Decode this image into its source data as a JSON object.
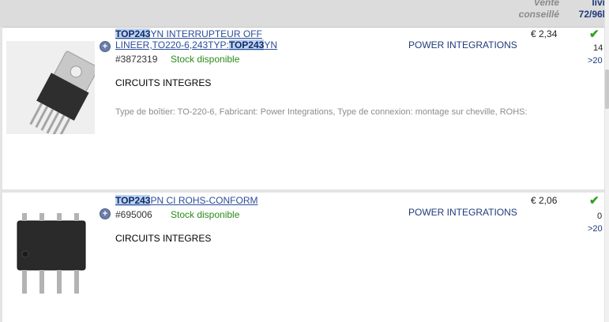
{
  "header": {
    "vente_line1": "Vente",
    "vente_line2": "conseillé",
    "livraison_line1": "livr.",
    "livraison_line2": "72/96h"
  },
  "products": [
    {
      "title_highlight_1": "TOP243",
      "title_rest_1": "YN INTERRUPTEUR OFF",
      "title_line2_a": "LINEER,TO220-6,243TYP:",
      "title_highlight_2": "TOP243",
      "title_line2_b": "YN",
      "ref": "#3872319",
      "stock": "Stock disponible",
      "category": "CIRCUITS INTEGRES",
      "description": "Type de boîtier: TO-220-6, Fabricant: Power Integrations, Type de connexion: montage sur cheville, ROHS:",
      "manufacturer": "POWER INTEGRATIONS",
      "price": "€ 2,34",
      "qty": "14",
      "delay": ">20"
    },
    {
      "title_highlight_1": "TOP243",
      "title_rest_1": "PN CI ROHS-CONFORM",
      "ref": "#695006",
      "stock": "Stock disponible",
      "category": "CIRCUITS INTEGRES",
      "manufacturer": "POWER INTEGRATIONS",
      "price": "€ 2,06",
      "qty": "0",
      "delay": ">20"
    }
  ],
  "icons": {
    "plus": "+",
    "check": "✔"
  }
}
